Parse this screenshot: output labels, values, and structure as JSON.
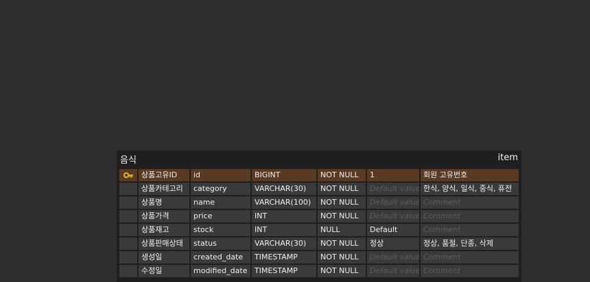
{
  "entity": {
    "logical_name": "음식",
    "physical_name": "item",
    "key_color": "#e0b020",
    "columns": [
      {
        "is_pk": true,
        "logical": "상품고유ID",
        "physical": "id",
        "type": "BIGINT",
        "nullable": "NOT NULL",
        "default": "1",
        "default_is_placeholder": false,
        "comment": "회원 고유번호",
        "comment_is_placeholder": false
      },
      {
        "is_pk": false,
        "logical": "상품카테고리",
        "physical": "category",
        "type": "VARCHAR(30)",
        "nullable": "NOT NULL",
        "default": "Default value",
        "default_is_placeholder": true,
        "comment": "한식, 양식, 일식, 중식, 퓨전",
        "comment_is_placeholder": false
      },
      {
        "is_pk": false,
        "logical": "상품명",
        "physical": "name",
        "type": "VARCHAR(100)",
        "nullable": "NOT NULL",
        "default": "Default value",
        "default_is_placeholder": true,
        "comment": "Comment",
        "comment_is_placeholder": true
      },
      {
        "is_pk": false,
        "logical": "상품가격",
        "physical": "price",
        "type": "INT",
        "nullable": "NOT NULL",
        "default": "Default value",
        "default_is_placeholder": true,
        "comment": "Comment",
        "comment_is_placeholder": true
      },
      {
        "is_pk": false,
        "logical": "상품재고",
        "physical": "stock",
        "type": "INT",
        "nullable": "NULL",
        "default": "Default",
        "default_is_placeholder": false,
        "comment": "Comment",
        "comment_is_placeholder": true
      },
      {
        "is_pk": false,
        "logical": "상품판매상태",
        "physical": "status",
        "type": "VARCHAR(30)",
        "nullable": "NOT NULL",
        "default": "정상",
        "default_is_placeholder": false,
        "comment": "정상, 품절, 단종, 삭제",
        "comment_is_placeholder": false
      },
      {
        "is_pk": false,
        "logical": "생성일",
        "physical": "created_date",
        "type": "TIMESTAMP",
        "nullable": "NOT NULL",
        "default": "Default value",
        "default_is_placeholder": true,
        "comment": "Comment",
        "comment_is_placeholder": true
      },
      {
        "is_pk": false,
        "logical": "수정일",
        "physical": "modified_date",
        "type": "TIMESTAMP",
        "nullable": "NOT NULL",
        "default": "Default value",
        "default_is_placeholder": true,
        "comment": "Comment",
        "comment_is_placeholder": true
      }
    ]
  }
}
